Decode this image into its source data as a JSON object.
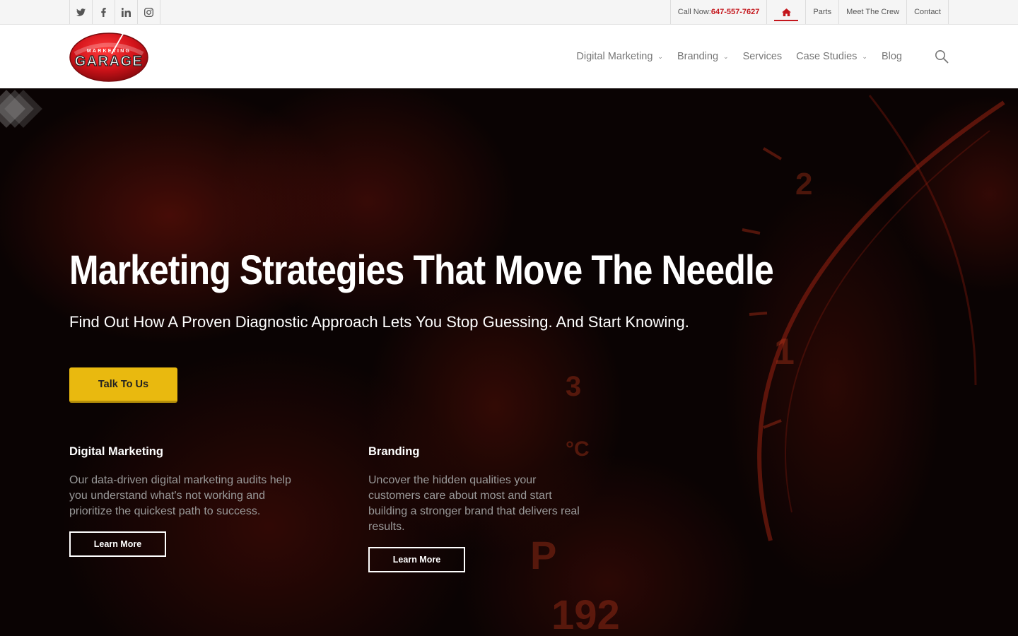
{
  "topbar": {
    "social": [
      {
        "icon": "twitter-icon",
        "glyph": "t"
      },
      {
        "icon": "facebook-icon",
        "glyph": "f"
      },
      {
        "icon": "linkedin-icon",
        "glyph": "in"
      },
      {
        "icon": "instagram-icon",
        "glyph": "◎"
      }
    ],
    "call_label": "Call Now:",
    "call_number": "647-557-7627",
    "links": [
      "Parts",
      "Meet The Crew",
      "Contact"
    ]
  },
  "header": {
    "logo": {
      "line1": "MARKETING",
      "line2": "GARAGE"
    },
    "nav": [
      {
        "label": "Digital Marketing",
        "dropdown": true
      },
      {
        "label": "Branding",
        "dropdown": true
      },
      {
        "label": "Services",
        "dropdown": false
      },
      {
        "label": "Case Studies",
        "dropdown": true
      },
      {
        "label": "Blog",
        "dropdown": false
      }
    ],
    "chevron": "⌄"
  },
  "hero": {
    "title": "Marketing Strategies That Move The Needle",
    "subtitle": "Find Out How A Proven Diagnostic Approach Lets You Stop Guessing. And Start Knowing.",
    "cta_label": "Talk To Us",
    "columns": [
      {
        "heading": "Digital Marketing",
        "text": "Our data-driven digital marketing audits help you understand what's not working and prioritize the quickest path to success.",
        "button": "Learn More"
      },
      {
        "heading": "Branding",
        "text": "Uncover the hidden qualities your customers care about most and start building a stronger brand that delivers real results.",
        "button": "Learn More"
      }
    ]
  },
  "colors": {
    "accent_red": "#c4161c",
    "cta_yellow": "#e9b90f",
    "hero_bg": "#0a0303"
  }
}
